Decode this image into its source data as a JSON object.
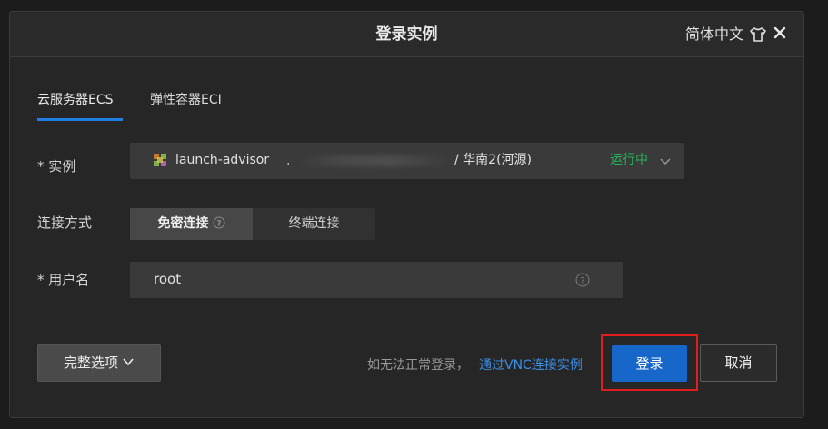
{
  "header": {
    "title": "登录实例",
    "language": "简体中文"
  },
  "tabs": [
    {
      "label": "云服务器ECS",
      "active": true
    },
    {
      "label": "弹性容器ECI",
      "active": false
    }
  ],
  "form": {
    "instance_label": "* 实例",
    "instance": {
      "name": "launch-advisor",
      "separator": ".",
      "region": "/ 华南2(河源)",
      "status": "运行中"
    },
    "connect_label": "连接方式",
    "connect_options": [
      {
        "label": "免密连接",
        "active": true
      },
      {
        "label": "终端连接",
        "active": false
      }
    ],
    "username_label": "* 用户名",
    "username_value": "root"
  },
  "footer": {
    "options_label": "完整选项",
    "hint": "如无法正常登录，",
    "vnc_link": "通过VNC连接实例",
    "login_label": "登录",
    "cancel_label": "取消"
  },
  "colors": {
    "accent": "#1766c9",
    "link": "#3b8fe6",
    "status_running": "#25b25b",
    "highlight": "#e21d1d"
  }
}
